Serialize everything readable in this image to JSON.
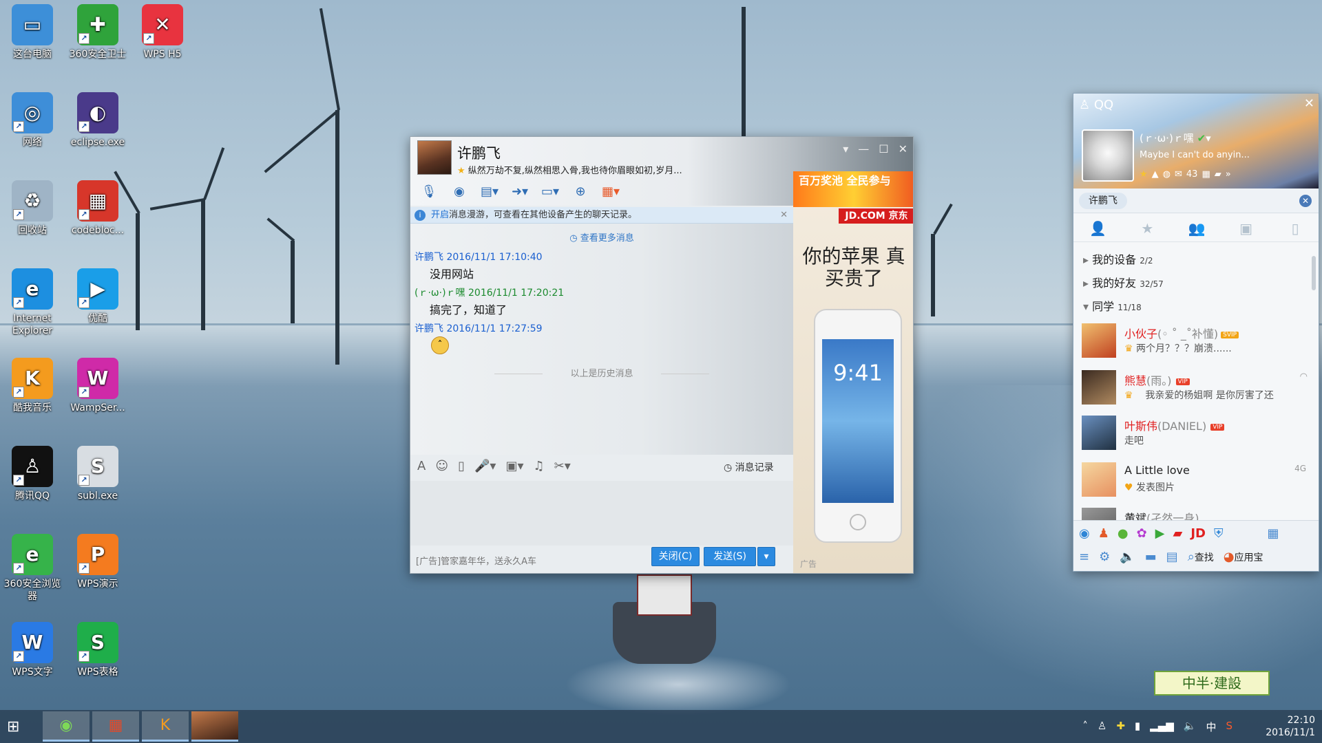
{
  "desktop": {
    "icons": [
      {
        "label": "这台电脑",
        "icon": "computer-icon",
        "color": "#3d8fd8"
      },
      {
        "label": "360安全卫士",
        "icon": "360-guard-icon",
        "color": "#2fa33b"
      },
      {
        "label": "WPS H5",
        "icon": "wps-h5-icon",
        "color": "#e8333f"
      },
      {
        "label": "网络",
        "icon": "network-icon",
        "color": "#3e8ed8"
      },
      {
        "label": "eclipse.exe",
        "icon": "eclipse-icon",
        "color": "#4a3a8a"
      },
      {
        "label": "回收站",
        "icon": "recycle-bin-icon",
        "color": "#9fb4c6"
      },
      {
        "label": "codebloc...",
        "icon": "codeblocks-icon",
        "color": "#d7362a"
      },
      {
        "label": "Internet Explorer",
        "icon": "ie-icon",
        "color": "#1d8fe0"
      },
      {
        "label": "优酷",
        "icon": "youku-icon",
        "color": "#1a9ee8"
      },
      {
        "label": "酷我音乐",
        "icon": "kuwo-icon",
        "color": "#f49b1e"
      },
      {
        "label": "WampSer...",
        "icon": "wampserver-icon",
        "color": "#cf2aa8"
      },
      {
        "label": "腾讯QQ",
        "icon": "qq-penguin-icon",
        "color": "#111111"
      },
      {
        "label": "subl.exe",
        "icon": "sublime-icon",
        "color": "#d8dde2"
      },
      {
        "label": "360安全浏览器",
        "icon": "360-browser-icon",
        "color": "#36b34a"
      },
      {
        "label": "WPS演示",
        "icon": "wps-presentation-icon",
        "color": "#f47b1f"
      },
      {
        "label": "WPS文字",
        "icon": "wps-writer-icon",
        "color": "#2a7ae4"
      },
      {
        "label": "WPS表格",
        "icon": "wps-spreadsheet-icon",
        "color": "#1fae4a"
      }
    ]
  },
  "chat": {
    "contact_name": "许鹏飞",
    "signature": "纵然万劫不复,纵然相思入骨,我也待你眉眼如初,岁月...",
    "toolbar_icons": [
      "voice-call-icon",
      "video-call-icon",
      "remote-assist-icon",
      "file-transfer-icon",
      "screen-share-icon",
      "create-group-icon",
      "apps-grid-icon"
    ],
    "info_bar": {
      "highlight": "开启",
      "text": "消息漫游，可查看在其他设备产生的聊天记录。"
    },
    "more_messages": "查看更多消息",
    "messages": [
      {
        "sender": "许鹏飞",
        "time": "2016/11/1 17:10:40",
        "text": "没用网站",
        "color": "#1a5fd0"
      },
      {
        "sender": "(ｒ·ω·)ｒ嘿",
        "time": "2016/11/1 17:20:21",
        "text": "搞完了，知道了",
        "color": "#1b8a2e"
      },
      {
        "sender": "许鹏飞",
        "time": "2016/11/1 17:27:59",
        "text": "",
        "color": "#1a5fd0"
      }
    ],
    "history_label": "以上是历史消息",
    "msg_record": "消息记录",
    "ad_text": "[广告]管家嘉年华，送永久A车",
    "close_button": "关闭(C)",
    "send_button": "发送(S)",
    "ad": {
      "banner": "百万奖池 全民参与",
      "banner_tag": "广告",
      "brand": "JD.COM 京东",
      "title": "你的苹果 真买贵了",
      "phone_time": "9:41",
      "tag": "广告"
    }
  },
  "qq": {
    "title": "QQ",
    "nickname": "(ｒ·ω·)ｒ嘿",
    "signature": "Maybe I can't do anyin...",
    "mail_count": "43",
    "search_tag": "许鹏飞",
    "tabs": [
      "contacts-icon",
      "favorites-icon",
      "groups-icon",
      "messages-icon",
      "phone-icon"
    ],
    "groups": [
      {
        "name": "我的设备",
        "count": "2/2"
      },
      {
        "name": "我的好友",
        "count": "32/57"
      },
      {
        "name": "同学",
        "count": "11/18"
      }
    ],
    "contacts": [
      {
        "name": "小伙子",
        "remark": "(◦ ˚ _˚补懂)",
        "badge": "SVIP",
        "msg": "两个月？？？崩溃......",
        "name_color": "#e02020"
      },
      {
        "name": "熊慧",
        "remark": "(雨。)",
        "badge": "VIP",
        "msg": "我亲爱的杨姐啊  是你厉害了还",
        "name_color": "#e02020"
      },
      {
        "name": "叶斯伟",
        "remark": "(DANIEL)",
        "badge": "VIP",
        "msg": "走吧",
        "name_color": "#e02020"
      },
      {
        "name": "A Little love",
        "remark": "",
        "badge": "",
        "msg": "发表图片",
        "name_color": "#222222",
        "net": "4G"
      },
      {
        "name": "黄斌",
        "remark": "(孑然一身)",
        "badge": "",
        "msg": "",
        "name_color": "#222222"
      }
    ],
    "bottom": {
      "find_label": "查找",
      "appstore_label": "应用宝"
    }
  },
  "stamp": "中半·建設",
  "taskbar": {
    "apps": [
      "360-browser-icon",
      "codeblocks-icon",
      "kuwo-icon",
      "chat-avatar-icon"
    ],
    "ime": "中",
    "time": "22:10",
    "date": "2016/11/1"
  }
}
